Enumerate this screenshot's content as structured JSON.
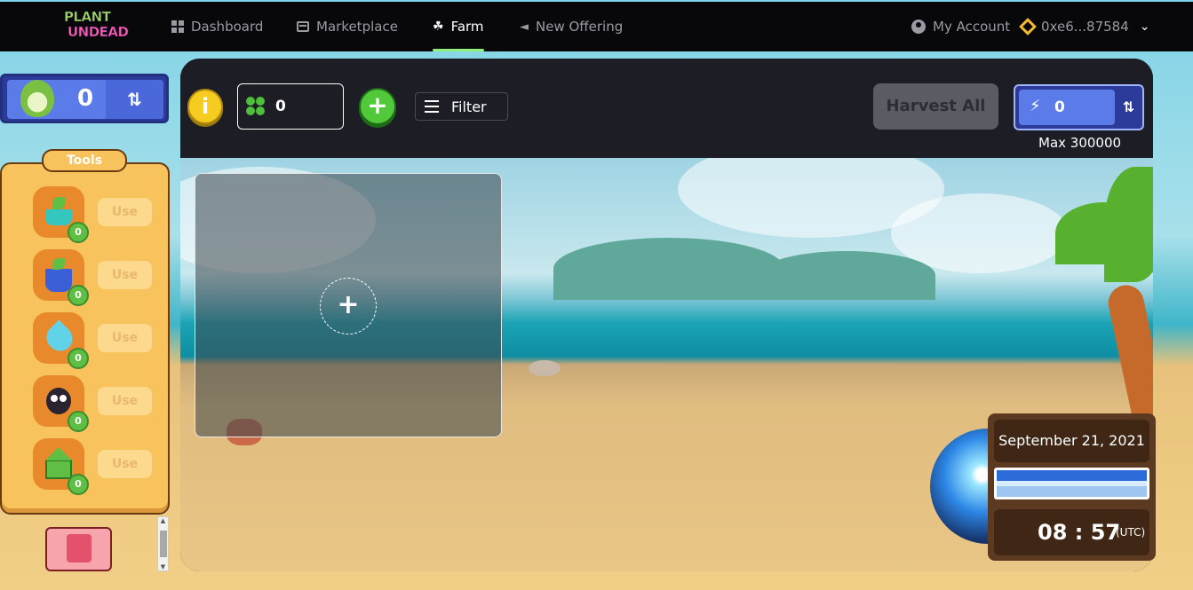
{
  "nav": {
    "logo_line1": "PLANT",
    "logo_line2": "UNDEAD",
    "items": [
      {
        "label": "Dashboard",
        "icon": "dashboard-icon"
      },
      {
        "label": "Marketplace",
        "icon": "marketplace-icon"
      },
      {
        "label": "Farm",
        "icon": "farm-icon",
        "active": true
      },
      {
        "label": "New Offering",
        "icon": "megaphone-icon"
      }
    ],
    "account_label": "My Account",
    "wallet_address": "0xe6...87584"
  },
  "sidebar": {
    "balance_value": "0",
    "tools_title": "Tools",
    "tools": [
      {
        "icon": "small-pot-icon",
        "count": "0",
        "use_label": "Use"
      },
      {
        "icon": "big-pot-icon",
        "count": "0",
        "use_label": "Use"
      },
      {
        "icon": "water-drop-icon",
        "count": "0",
        "use_label": "Use"
      },
      {
        "icon": "scarecrow-icon",
        "count": "0",
        "use_label": "Use"
      },
      {
        "icon": "greenhouse-icon",
        "count": "0",
        "use_label": "Use"
      }
    ]
  },
  "toolbar": {
    "info_label": "i",
    "clover_value": "0",
    "add_label": "+",
    "filter_label": "Filter",
    "harvest_label": "Harvest All",
    "energy_value": "0",
    "energy_max": "Max 300000"
  },
  "farm": {
    "slot_add_label": "+"
  },
  "clock": {
    "date": "September 21, 2021",
    "time": "08 : 57",
    "timezone": "(UTC)"
  },
  "colors": {
    "nav_bg": "#08080b",
    "active_underline": "#8ff07a",
    "panel_bg": "#1c1d25",
    "tools_bg": "#f8c35c",
    "energy_bg": "#5a7be8"
  }
}
